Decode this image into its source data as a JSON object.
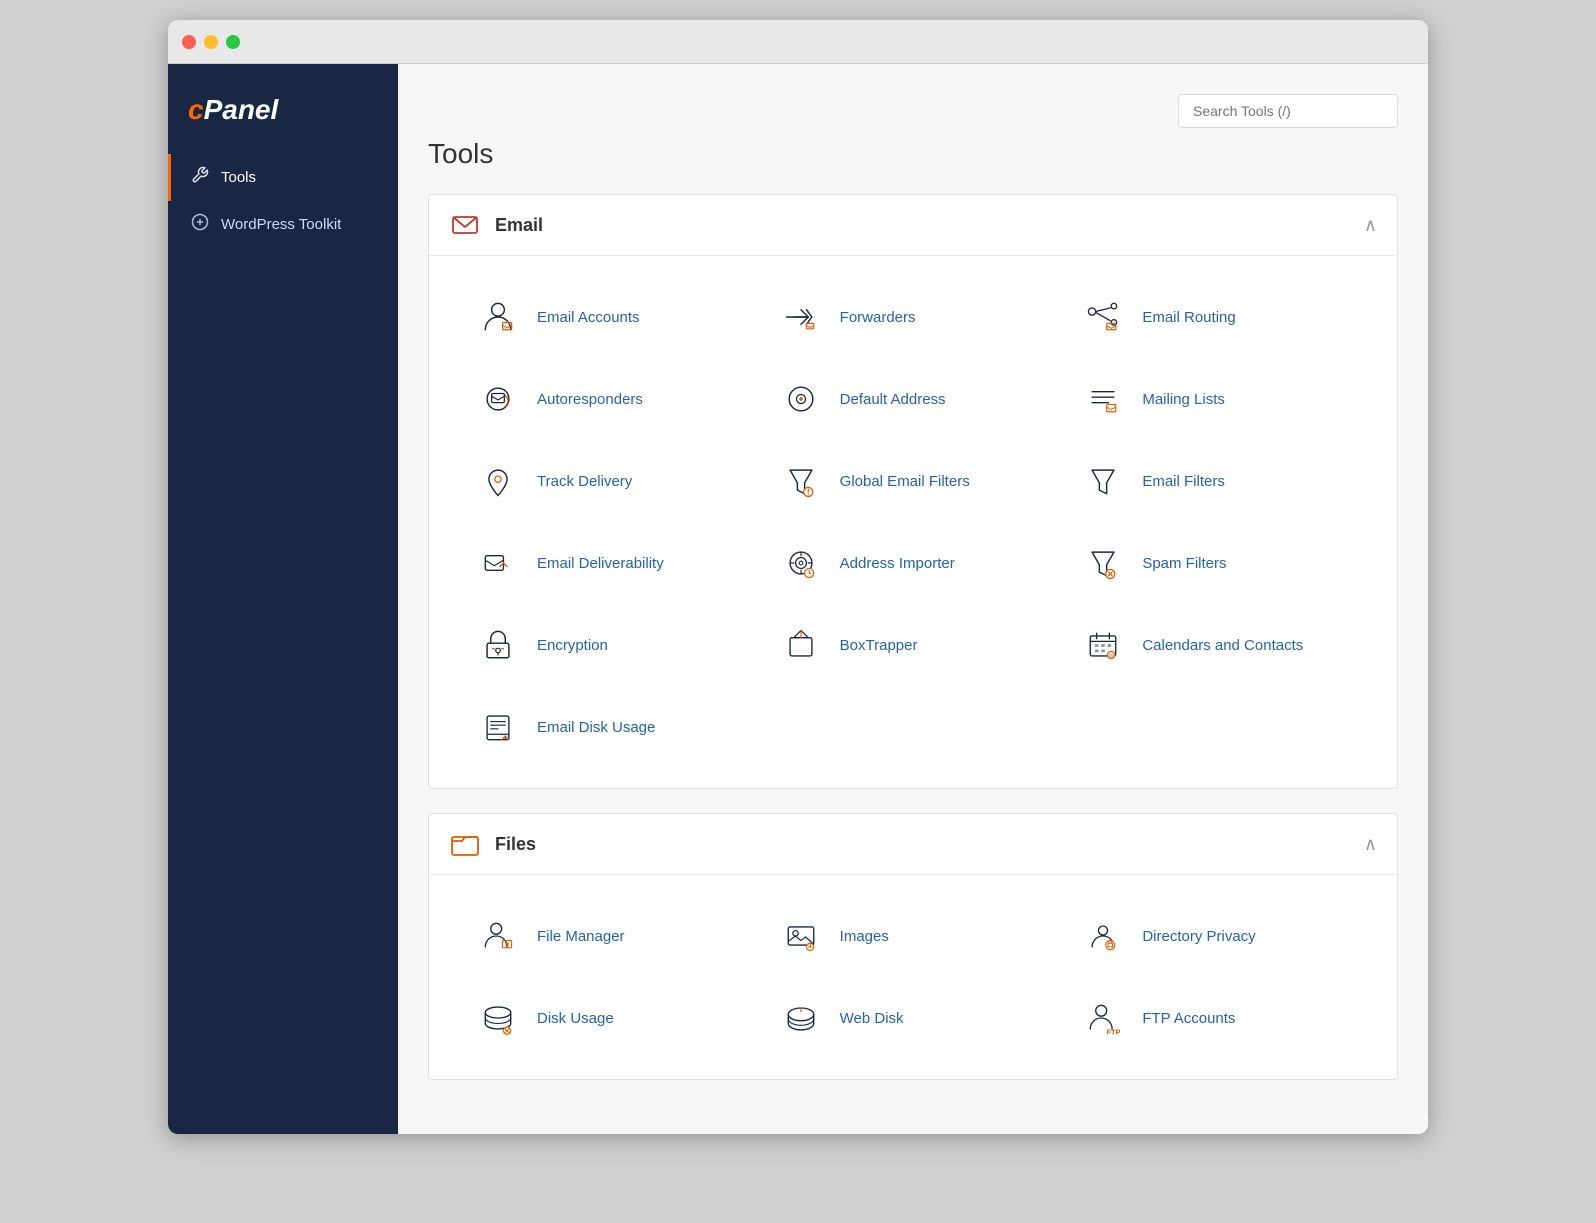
{
  "window": {
    "title": "cPanel"
  },
  "sidebar": {
    "logo": "cPanel",
    "items": [
      {
        "id": "tools",
        "label": "Tools",
        "icon": "tools-icon",
        "active": true
      },
      {
        "id": "wordpress",
        "label": "WordPress Toolkit",
        "icon": "wordpress-icon",
        "active": false
      }
    ]
  },
  "header": {
    "search_placeholder": "Search Tools (/)",
    "page_title": "Tools"
  },
  "sections": [
    {
      "id": "email",
      "title": "Email",
      "icon": "email-section-icon",
      "collapsed": false,
      "tools": [
        {
          "id": "email-accounts",
          "label": "Email Accounts",
          "icon": "email-accounts-icon"
        },
        {
          "id": "forwarders",
          "label": "Forwarders",
          "icon": "forwarders-icon"
        },
        {
          "id": "email-routing",
          "label": "Email Routing",
          "icon": "email-routing-icon"
        },
        {
          "id": "autoresponders",
          "label": "Autoresponders",
          "icon": "autoresponders-icon"
        },
        {
          "id": "default-address",
          "label": "Default Address",
          "icon": "default-address-icon"
        },
        {
          "id": "mailing-lists",
          "label": "Mailing Lists",
          "icon": "mailing-lists-icon"
        },
        {
          "id": "track-delivery",
          "label": "Track Delivery",
          "icon": "track-delivery-icon"
        },
        {
          "id": "global-email-filters",
          "label": "Global Email Filters",
          "icon": "global-email-filters-icon"
        },
        {
          "id": "email-filters",
          "label": "Email Filters",
          "icon": "email-filters-icon"
        },
        {
          "id": "email-deliverability",
          "label": "Email Deliverability",
          "icon": "email-deliverability-icon"
        },
        {
          "id": "address-importer",
          "label": "Address Importer",
          "icon": "address-importer-icon"
        },
        {
          "id": "spam-filters",
          "label": "Spam Filters",
          "icon": "spam-filters-icon"
        },
        {
          "id": "encryption",
          "label": "Encryption",
          "icon": "encryption-icon"
        },
        {
          "id": "boxtrapper",
          "label": "BoxTrapper",
          "icon": "boxtrapper-icon"
        },
        {
          "id": "calendars-contacts",
          "label": "Calendars and Contacts",
          "icon": "calendars-contacts-icon"
        },
        {
          "id": "email-disk-usage",
          "label": "Email Disk Usage",
          "icon": "email-disk-usage-icon"
        }
      ]
    },
    {
      "id": "files",
      "title": "Files",
      "icon": "files-section-icon",
      "collapsed": false,
      "tools": [
        {
          "id": "file-manager",
          "label": "File Manager",
          "icon": "file-manager-icon"
        },
        {
          "id": "images",
          "label": "Images",
          "icon": "images-icon"
        },
        {
          "id": "directory-privacy",
          "label": "Directory Privacy",
          "icon": "directory-privacy-icon"
        },
        {
          "id": "disk-usage",
          "label": "Disk Usage",
          "icon": "disk-usage-icon"
        },
        {
          "id": "web-disk",
          "label": "Web Disk",
          "icon": "web-disk-icon"
        },
        {
          "id": "ftp-accounts",
          "label": "FTP Accounts",
          "icon": "ftp-accounts-icon"
        }
      ]
    }
  ]
}
